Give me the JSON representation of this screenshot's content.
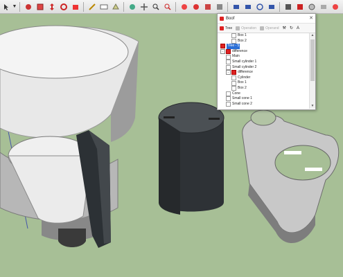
{
  "toolbar": {
    "icons": [
      "select-icon",
      "dropdown-arrow",
      "paint-icon",
      "component-icon",
      "move-icon",
      "rotate-icon",
      "scale-icon",
      "push-pull-icon",
      "measure-icon",
      "text-icon",
      "section-icon",
      "orbit-icon",
      "pan-icon",
      "zoom-icon",
      "zoom-extents-icon",
      "model-info-icon",
      "layers-icon",
      "styles-icon",
      "scenes-icon",
      "iso-view-icon",
      "top-view-icon",
      "front-view-icon",
      "right-view-icon",
      "back-view-icon",
      "boof-icon",
      "xray-icon",
      "wireframe-icon",
      "hidden-line-icon",
      "shaded-icon",
      "textured-icon",
      "monochrome-icon"
    ]
  },
  "dialog": {
    "title": "Boof",
    "toolbar": {
      "tree": "Tree",
      "operation": "Operation",
      "operand": "Operand"
    },
    "tree": [
      {
        "label": "Box 1",
        "indent": 2,
        "icon": "box",
        "expander": ""
      },
      {
        "label": "Box 2",
        "indent": 2,
        "icon": "box",
        "expander": ""
      },
      {
        "label": "Tree - 5",
        "indent": 0,
        "icon": "red",
        "expander": "",
        "selected": true
      },
      {
        "label": "difference",
        "indent": 0,
        "icon": "red",
        "expander": "−"
      },
      {
        "label": "Main",
        "indent": 1,
        "icon": "box",
        "expander": ""
      },
      {
        "label": "Small cylinder 1",
        "indent": 1,
        "icon": "box",
        "expander": ""
      },
      {
        "label": "Small cylinder 2",
        "indent": 1,
        "icon": "box",
        "expander": ""
      },
      {
        "label": "difference",
        "indent": 1,
        "icon": "red",
        "expander": "−"
      },
      {
        "label": "Cylinder",
        "indent": 2,
        "icon": "box",
        "expander": ""
      },
      {
        "label": "Box 1",
        "indent": 2,
        "icon": "box",
        "expander": ""
      },
      {
        "label": "Box 2",
        "indent": 2,
        "icon": "box",
        "expander": ""
      },
      {
        "label": "Cone",
        "indent": 1,
        "icon": "box",
        "expander": ""
      },
      {
        "label": "Small cone 1",
        "indent": 1,
        "icon": "box",
        "expander": ""
      },
      {
        "label": "Small cone 2",
        "indent": 1,
        "icon": "box",
        "expander": ""
      }
    ]
  },
  "colors": {
    "ground": "#a7bf96",
    "selection": "#2b6fd6",
    "brand_red": "#d22222"
  }
}
